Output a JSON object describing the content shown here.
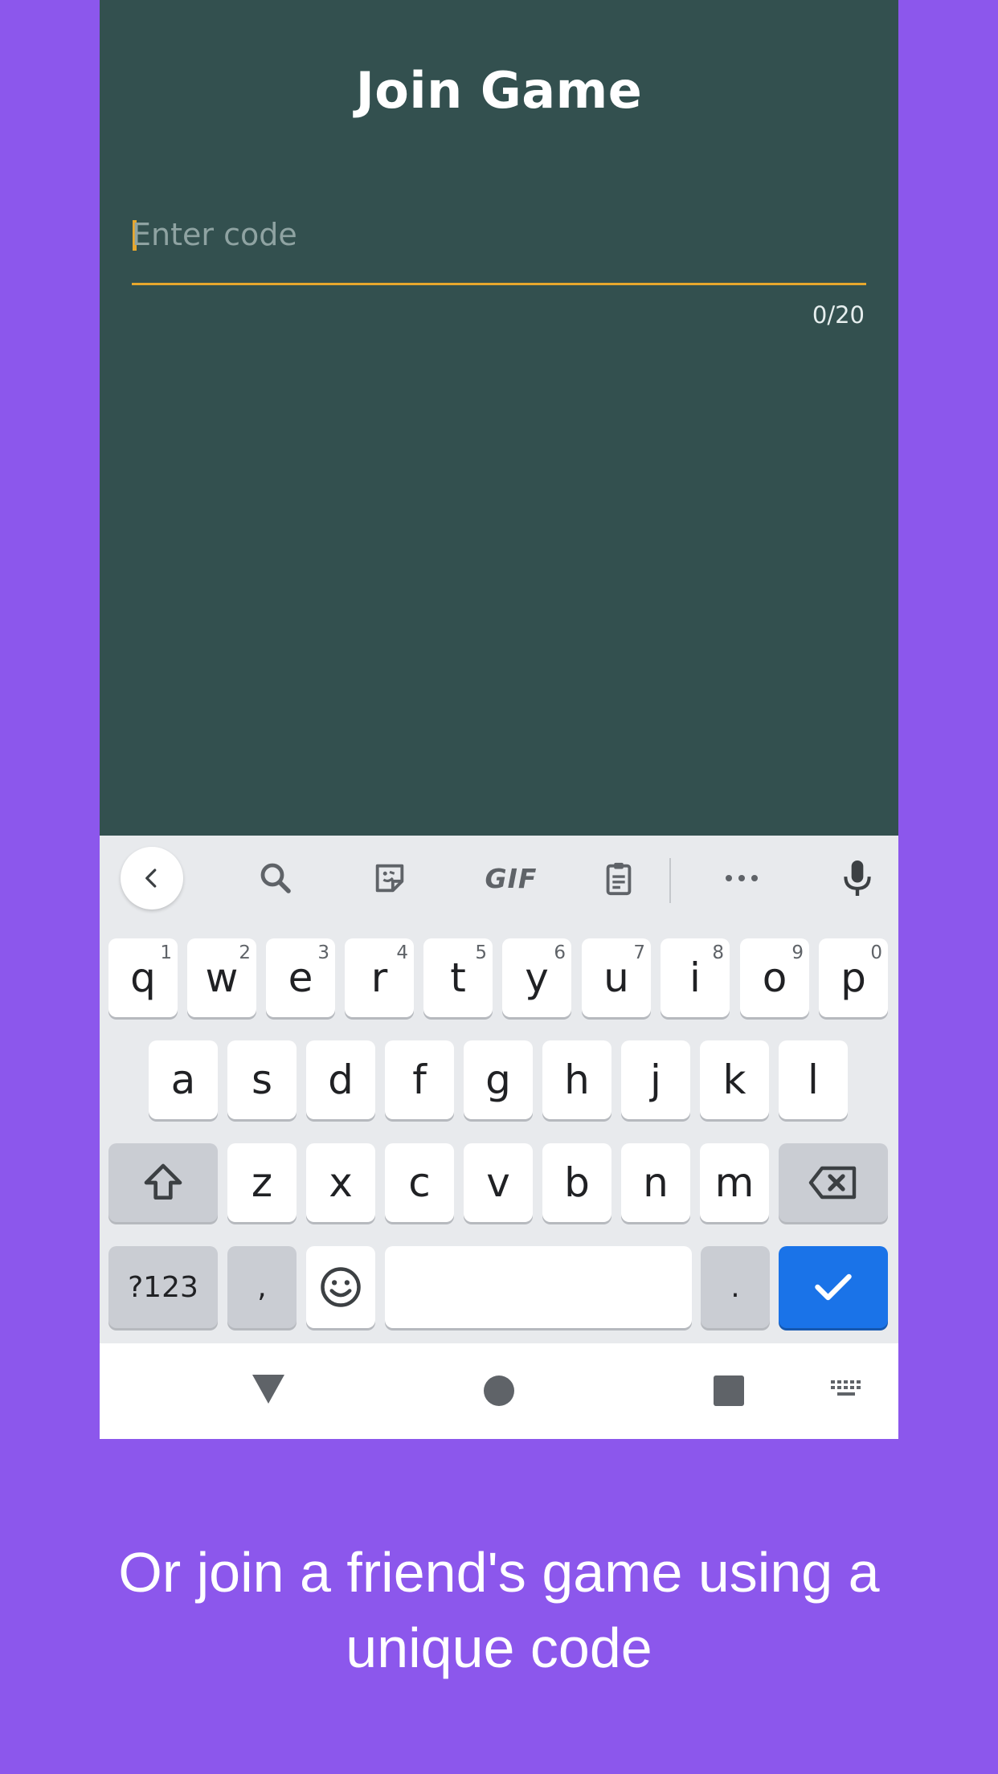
{
  "screen": {
    "title": "Join Game",
    "code_input": {
      "value": "",
      "placeholder": "Enter code"
    },
    "counter": "0/20"
  },
  "keyboard": {
    "toolbar": [
      "back-icon",
      "search-icon",
      "sticker-icon",
      "GIF",
      "clipboard-icon",
      "more-icon",
      "mic-icon"
    ],
    "row1": [
      {
        "key": "q",
        "hint": "1"
      },
      {
        "key": "w",
        "hint": "2"
      },
      {
        "key": "e",
        "hint": "3"
      },
      {
        "key": "r",
        "hint": "4"
      },
      {
        "key": "t",
        "hint": "5"
      },
      {
        "key": "y",
        "hint": "6"
      },
      {
        "key": "u",
        "hint": "7"
      },
      {
        "key": "i",
        "hint": "8"
      },
      {
        "key": "o",
        "hint": "9"
      },
      {
        "key": "p",
        "hint": "0"
      }
    ],
    "row2": [
      "a",
      "s",
      "d",
      "f",
      "g",
      "h",
      "j",
      "k",
      "l"
    ],
    "row3": [
      "z",
      "x",
      "c",
      "v",
      "b",
      "n",
      "m"
    ],
    "row4": {
      "symbols": "?123",
      "comma": ",",
      "period": "."
    }
  },
  "caption": {
    "line1": "Or join a friend's game using a",
    "line2": "unique code"
  },
  "colors": {
    "background": "#8c57ec",
    "screen": "#33504f",
    "accent": "#e7a72d",
    "enter_key": "#1a73e8"
  }
}
